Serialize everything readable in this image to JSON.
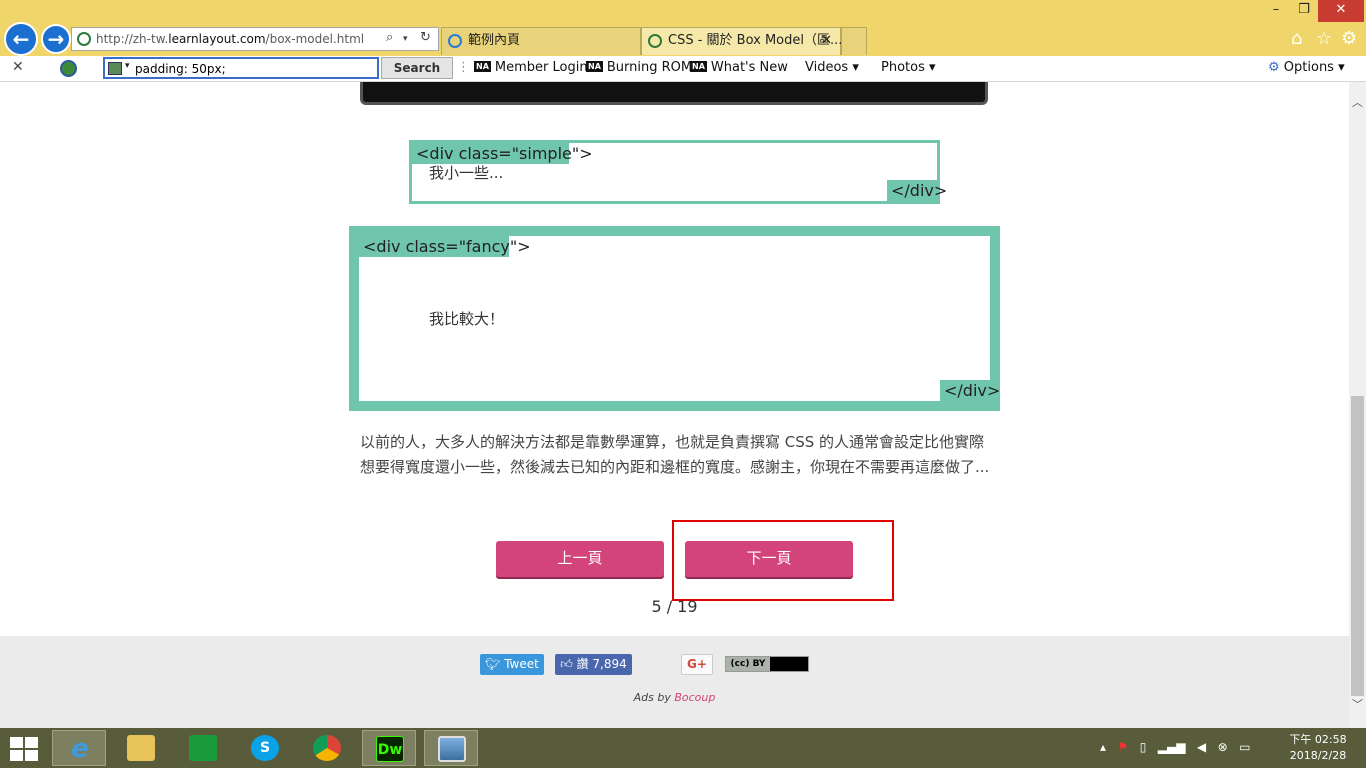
{
  "browser": {
    "url_prefix": "http://zh-tw.",
    "url_domain": "learnlayout.com",
    "url_path": "/box-model.html",
    "tabs": [
      {
        "label": "範例內頁"
      },
      {
        "label": "CSS - 關於 Box Model（區..."
      }
    ]
  },
  "toolbar": {
    "search_value": "padding: 50px;",
    "search_button": "Search",
    "na_badge": "NA",
    "links": [
      "Member Login",
      "Burning ROM",
      "What's New"
    ],
    "dropdowns": [
      "Videos ▾",
      "Photos ▾"
    ],
    "options_label": "Options"
  },
  "page": {
    "simple_open": "<div class=\"simple\">",
    "simple_text": "我小一些...",
    "simple_close": "</div>",
    "fancy_open": "<div class=\"fancy\">",
    "fancy_text": "我比較大！",
    "fancy_close": "</div>",
    "paragraph": "以前的人，大多人的解決方法都是靠數學運算，也就是負責撰寫 CSS 的人通常會設定比他實際想要得寬度還小一些，然後減去已知的內距和邊框的寬度。感謝主，你現在不需要再這麼做了...",
    "prev_label": "上一頁",
    "next_label": "下一頁",
    "page_count": "5 / 19",
    "accent_color": "#d2447a",
    "box_color": "#6fc6ad"
  },
  "footer": {
    "tweet_label": "Tweet",
    "fb_label": "讚 7,894",
    "gplus_label": "G+",
    "cc_label": "BY",
    "ads_prefix": "Ads by ",
    "ads_brand": "Bocoup"
  },
  "taskbar": {
    "apps": [
      "ie-icon",
      "file-explorer-icon",
      "store-icon",
      "skype-icon",
      "chrome-icon",
      "dreamweaver-icon",
      "photo-viewer-icon"
    ],
    "dw_label": "Dw",
    "time": "下午 02:58",
    "date": "2018/2/28"
  }
}
